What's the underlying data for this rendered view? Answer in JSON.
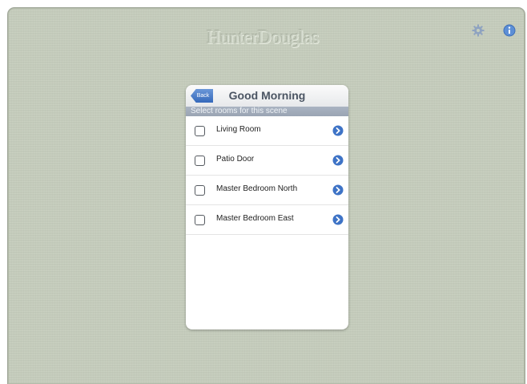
{
  "brand": {
    "logo": "HunterDouglas"
  },
  "top_icons": {
    "settings_icon": "gear-icon",
    "info_icon": "info-icon"
  },
  "popover": {
    "back_label": "Back",
    "title": "Good Morning",
    "section_header": "Select rooms for this scene",
    "rooms": [
      {
        "label": "Living Room",
        "checked": false
      },
      {
        "label": "Patio Door",
        "checked": false
      },
      {
        "label": "Master Bedroom North",
        "checked": false
      },
      {
        "label": "Master Bedroom East",
        "checked": false
      }
    ]
  },
  "colors": {
    "background": "#c7cfbe",
    "accent_blue": "#3e73c6",
    "section_header": "#a3adbc"
  }
}
